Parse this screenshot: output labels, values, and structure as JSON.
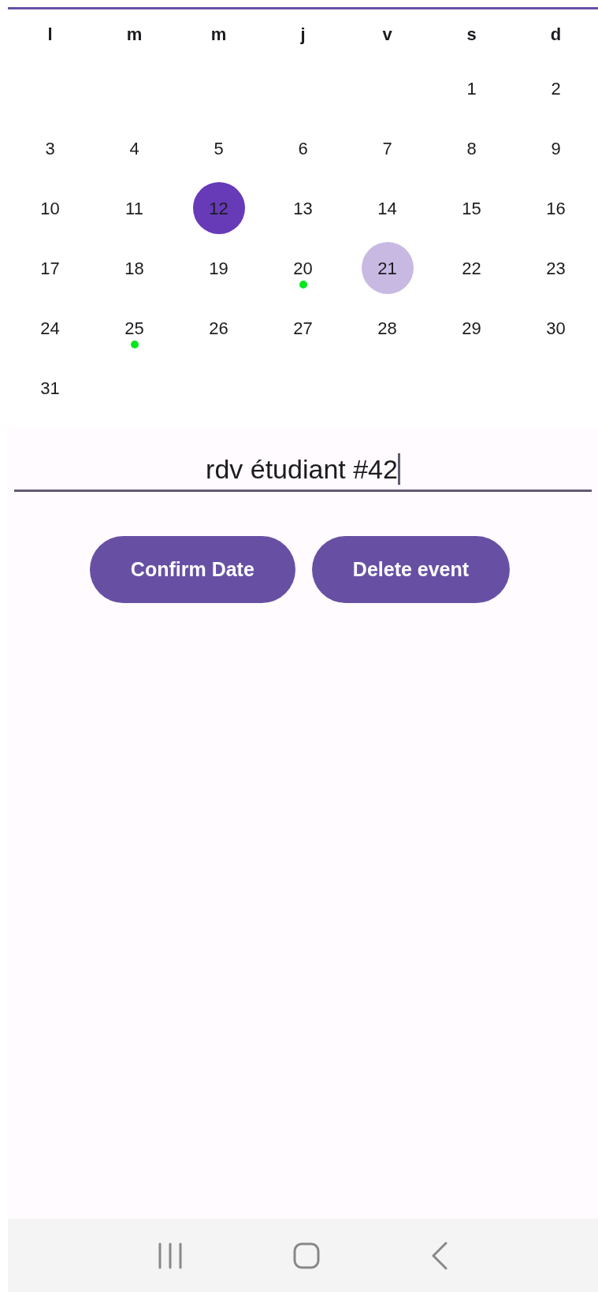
{
  "calendar": {
    "weekdays": [
      "l",
      "m",
      "m",
      "j",
      "v",
      "s",
      "d"
    ],
    "weeks": [
      [
        {
          "kind": "empty"
        },
        {
          "kind": "empty"
        },
        {
          "kind": "empty"
        },
        {
          "kind": "empty"
        },
        {
          "kind": "empty"
        },
        {
          "kind": "day",
          "label": "1",
          "selected": false,
          "today": false,
          "has_event": false
        },
        {
          "kind": "day",
          "label": "2",
          "selected": false,
          "today": false,
          "has_event": false
        }
      ],
      [
        {
          "kind": "day",
          "label": "3",
          "selected": false,
          "today": false,
          "has_event": false
        },
        {
          "kind": "day",
          "label": "4",
          "selected": false,
          "today": false,
          "has_event": false
        },
        {
          "kind": "day",
          "label": "5",
          "selected": false,
          "today": false,
          "has_event": false
        },
        {
          "kind": "day",
          "label": "6",
          "selected": false,
          "today": false,
          "has_event": false
        },
        {
          "kind": "day",
          "label": "7",
          "selected": false,
          "today": false,
          "has_event": false
        },
        {
          "kind": "day",
          "label": "8",
          "selected": false,
          "today": false,
          "has_event": false
        },
        {
          "kind": "day",
          "label": "9",
          "selected": false,
          "today": false,
          "has_event": false
        }
      ],
      [
        {
          "kind": "day",
          "label": "10",
          "selected": false,
          "today": false,
          "has_event": false
        },
        {
          "kind": "day",
          "label": "11",
          "selected": false,
          "today": false,
          "has_event": false
        },
        {
          "kind": "day",
          "label": "12",
          "selected": true,
          "today": false,
          "has_event": false
        },
        {
          "kind": "day",
          "label": "13",
          "selected": false,
          "today": false,
          "has_event": false
        },
        {
          "kind": "day",
          "label": "14",
          "selected": false,
          "today": false,
          "has_event": false
        },
        {
          "kind": "day",
          "label": "15",
          "selected": false,
          "today": false,
          "has_event": false
        },
        {
          "kind": "day",
          "label": "16",
          "selected": false,
          "today": false,
          "has_event": false
        }
      ],
      [
        {
          "kind": "day",
          "label": "17",
          "selected": false,
          "today": false,
          "has_event": false
        },
        {
          "kind": "day",
          "label": "18",
          "selected": false,
          "today": false,
          "has_event": false
        },
        {
          "kind": "day",
          "label": "19",
          "selected": false,
          "today": false,
          "has_event": false
        },
        {
          "kind": "day",
          "label": "20",
          "selected": false,
          "today": false,
          "has_event": true
        },
        {
          "kind": "day",
          "label": "21",
          "selected": false,
          "today": true,
          "has_event": false
        },
        {
          "kind": "day",
          "label": "22",
          "selected": false,
          "today": false,
          "has_event": false
        },
        {
          "kind": "day",
          "label": "23",
          "selected": false,
          "today": false,
          "has_event": false
        }
      ],
      [
        {
          "kind": "day",
          "label": "24",
          "selected": false,
          "today": false,
          "has_event": false
        },
        {
          "kind": "day",
          "label": "25",
          "selected": false,
          "today": false,
          "has_event": true
        },
        {
          "kind": "day",
          "label": "26",
          "selected": false,
          "today": false,
          "has_event": false
        },
        {
          "kind": "day",
          "label": "27",
          "selected": false,
          "today": false,
          "has_event": false
        },
        {
          "kind": "day",
          "label": "28",
          "selected": false,
          "today": false,
          "has_event": false
        },
        {
          "kind": "day",
          "label": "29",
          "selected": false,
          "today": false,
          "has_event": false
        },
        {
          "kind": "day",
          "label": "30",
          "selected": false,
          "today": false,
          "has_event": false
        }
      ],
      [
        {
          "kind": "day",
          "label": "31",
          "selected": false,
          "today": false,
          "has_event": false
        }
      ]
    ]
  },
  "event_field": {
    "value": "rdv étudiant #42"
  },
  "buttons": [
    "Confirm Date",
    "Delete event"
  ]
}
